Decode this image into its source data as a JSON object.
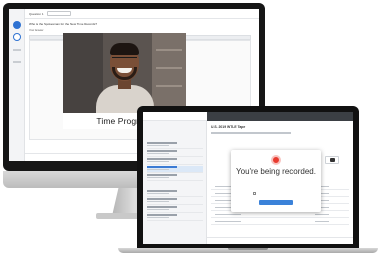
{
  "desktop_app": {
    "question_label": "Question 1",
    "question_text": "Who is the Spokesman for the New Time Records?",
    "answer_label": "Your Answer",
    "video_caption": "Time Progress"
  },
  "laptop_app": {
    "page_title": "U.S. 2019 WTLE Tape",
    "modal": {
      "title": "You're being recorded."
    }
  },
  "colors": {
    "accent": "#3b82d9",
    "recording": "#e83b2f",
    "laptop_header": "#3b3f44"
  }
}
